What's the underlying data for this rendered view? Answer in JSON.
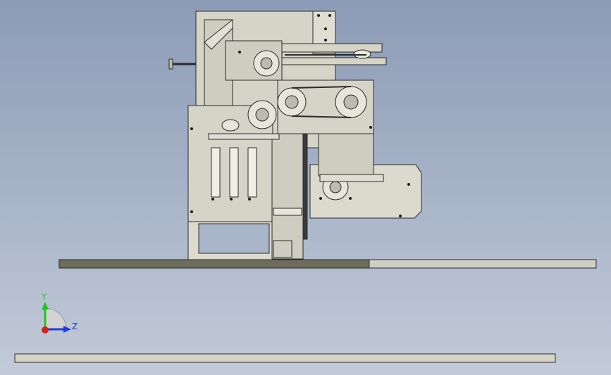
{
  "viewport": {
    "background_top": "#8c9bb6",
    "background_bottom": "#c3cad8"
  },
  "model": {
    "part_fill": "#d6d4c6",
    "part_stroke": "#2a2a2a",
    "floor_fill": "#6e6d5c",
    "floor_light_fill": "#cfd0c4"
  },
  "triad": {
    "y_label": "Y",
    "z_label": "Z",
    "y_color": "#1ec51e",
    "z_color": "#1f3ed6",
    "x_color": "#d62020"
  }
}
